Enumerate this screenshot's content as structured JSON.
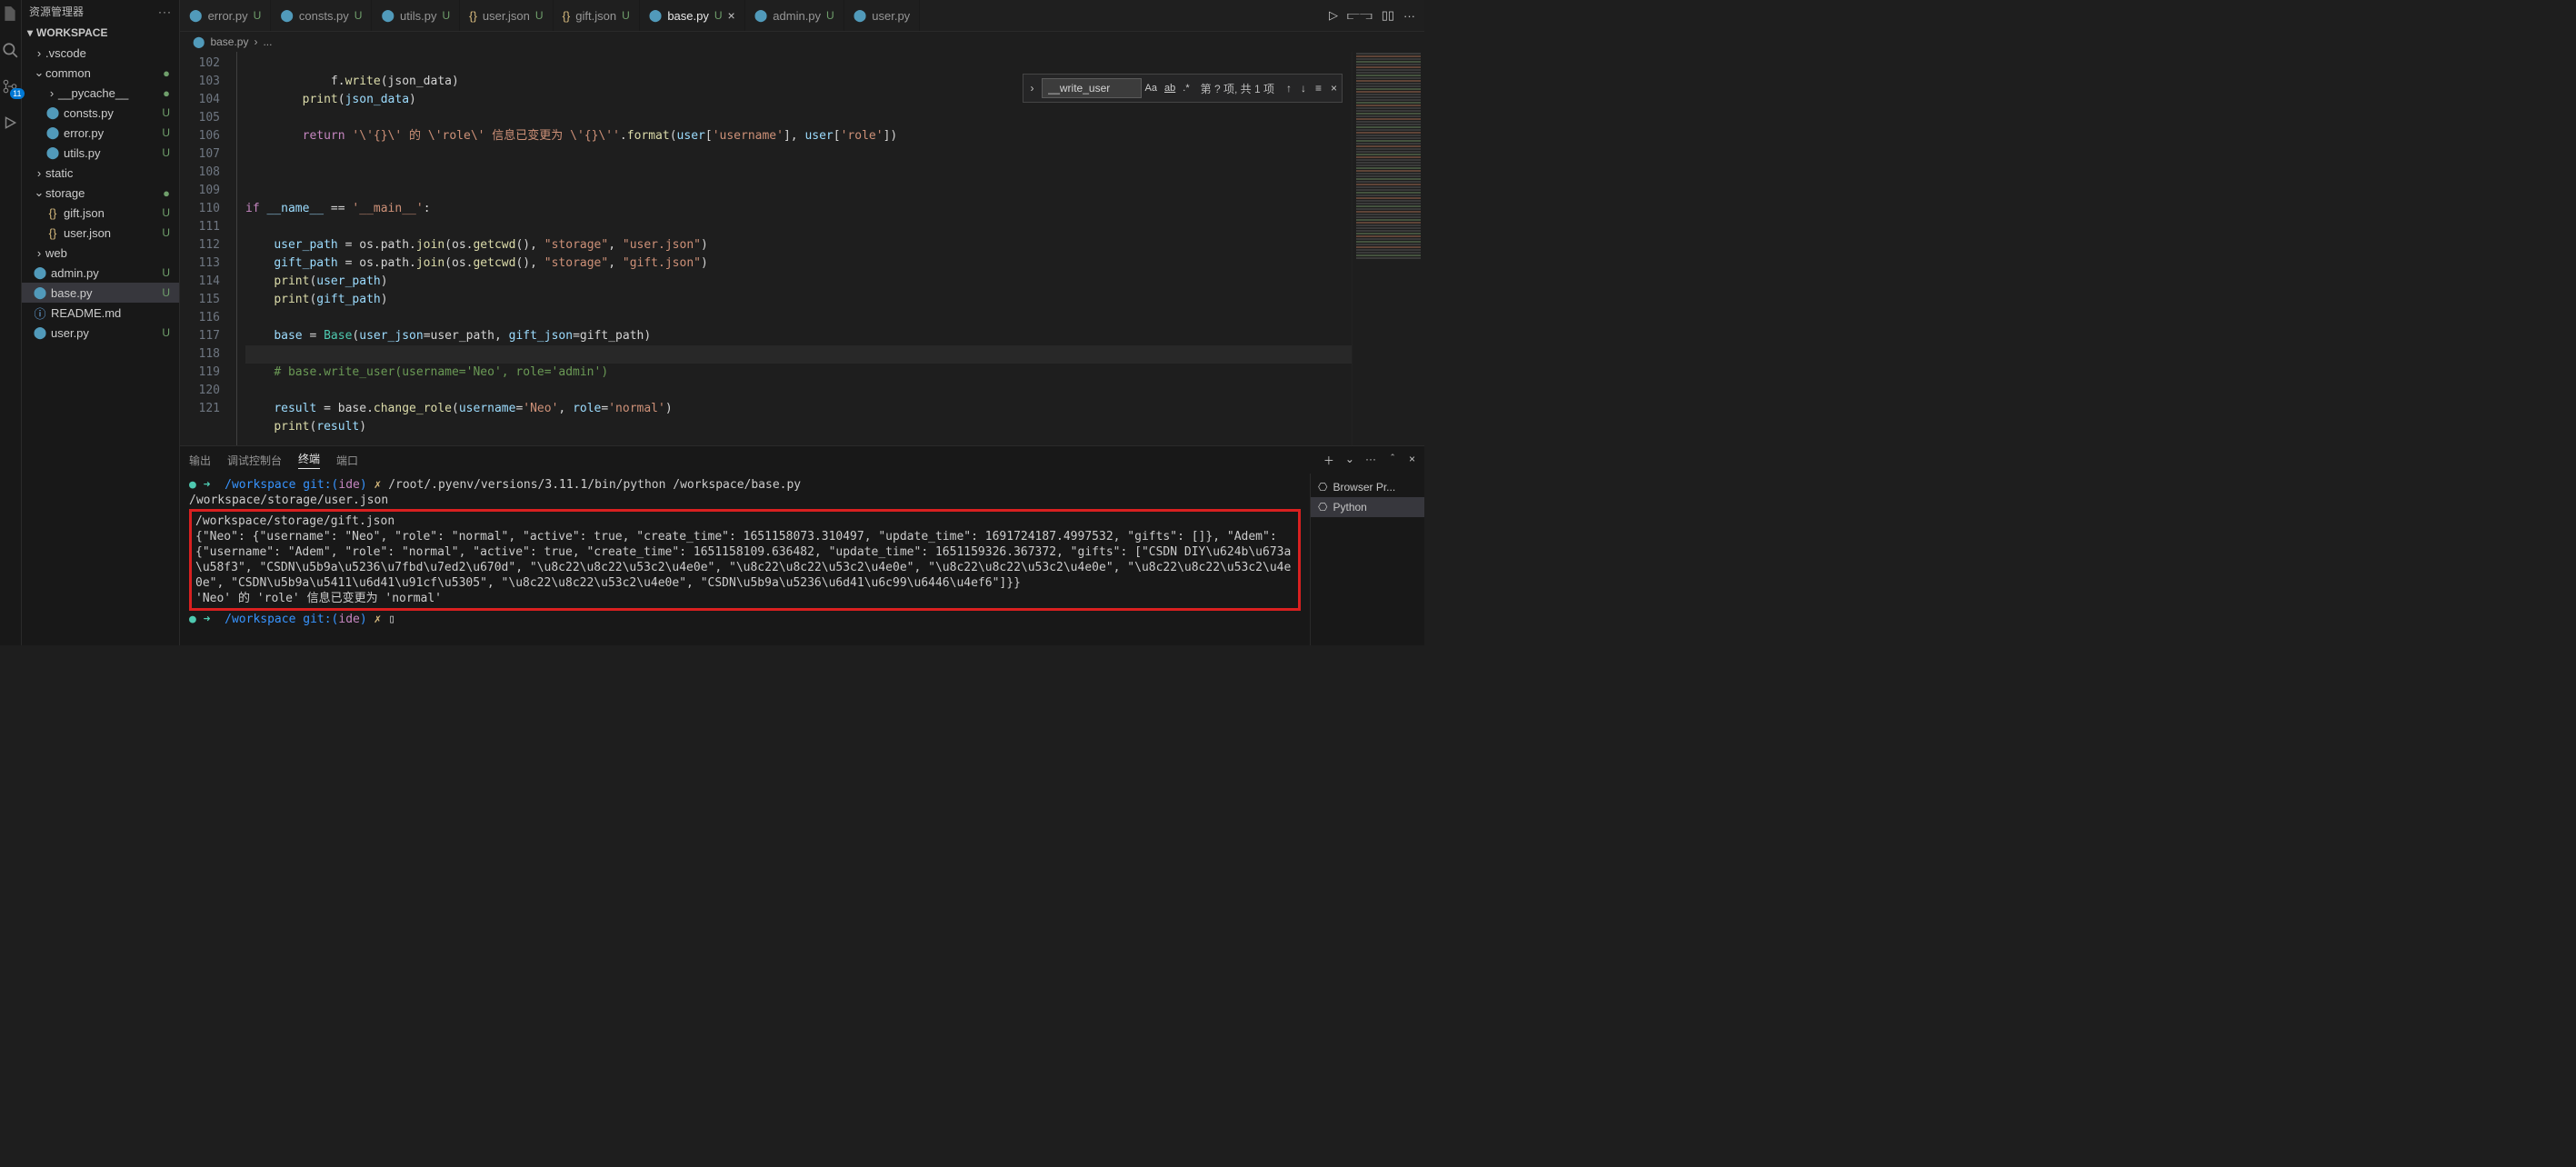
{
  "explorer_title": "资源管理器",
  "workspace_label": "WORKSPACE",
  "activity_badge": "11",
  "tree": {
    "vscode": ".vscode",
    "common": "common",
    "pycache": "__pycache__",
    "consts": "consts.py",
    "error": "error.py",
    "utils": "utils.py",
    "static": "static",
    "storage": "storage",
    "gift_json": "gift.json",
    "user_json": "user.json",
    "web": "web",
    "admin": "admin.py",
    "base": "base.py",
    "readme": "README.md",
    "user": "user.py",
    "status_U": "U",
    "status_dot": "●"
  },
  "tabs": [
    {
      "icon": "py",
      "label": "error.py",
      "status": "U"
    },
    {
      "icon": "py",
      "label": "consts.py",
      "status": "U"
    },
    {
      "icon": "py",
      "label": "utils.py",
      "status": "U"
    },
    {
      "icon": "json",
      "label": "user.json",
      "status": "U"
    },
    {
      "icon": "json",
      "label": "gift.json",
      "status": "U"
    },
    {
      "icon": "py",
      "label": "base.py",
      "status": "U",
      "active": true,
      "close": true
    },
    {
      "icon": "py",
      "label": "admin.py",
      "status": "U"
    },
    {
      "icon": "py",
      "label": "user.py"
    }
  ],
  "breadcrumb": {
    "file": "base.py",
    "sep": "›",
    "more": "..."
  },
  "find": {
    "value": "__write_user",
    "opt_case": "Aa",
    "opt_word": "ab",
    "opt_regex": ".*",
    "info": "第 ? 项, 共 1 项"
  },
  "gutter": [
    "102",
    "103",
    "104",
    "105",
    "106",
    "107",
    "108",
    "109",
    "110",
    "111",
    "112",
    "113",
    "114",
    "115",
    "116",
    "117",
    "118",
    "119",
    "120",
    "121"
  ],
  "code": {
    "l102": "            f.write(json_data)",
    "l103": "        print(json_data)",
    "l104": "",
    "l105": "        return '\\'{}\\' 的 \\'role\\' 信息已变更为 \\'{}\\''.format(user['username'], user['role'])",
    "l106": "",
    "l107": "",
    "l108": "",
    "l109": "if __name__ == '__main__':",
    "l110": "",
    "l111": "    user_path = os.path.join(os.getcwd(), \"storage\", \"user.json\")",
    "l112": "    gift_path = os.path.join(os.getcwd(), \"storage\", \"gift.json\")",
    "l113": "    print(user_path)",
    "l114": "    print(gift_path)",
    "l115": "",
    "l116": "    base = Base(user_json=user_path, gift_json=gift_path)",
    "l117": "",
    "l118": "    # base.write_user(username='Neo', role='admin')",
    "l119": "",
    "l120": "    result = base.change_role(username='Neo', role='normal')",
    "l121": "    print(result)"
  },
  "panel_tabs": {
    "output": "输出",
    "debug": "调试控制台",
    "terminal": "终端",
    "ports": "端口"
  },
  "terminal": {
    "prompt_arrow": "➜",
    "prompt_path": "/workspace",
    "prompt_git": "git:(",
    "prompt_branch": "ide",
    "prompt_git_close": ")",
    "prompt_x": "✗",
    "cmd": "/root/.pyenv/versions/3.11.1/bin/python /workspace/base.py",
    "out1": "/workspace/storage/user.json",
    "out2": "/workspace/storage/gift.json",
    "json_blob": "{\"Neo\": {\"username\": \"Neo\", \"role\": \"normal\", \"active\": true, \"create_time\": 1651158073.310497, \"update_time\": 1691724187.4997532, \"gifts\": []}, \"Adem\": {\"username\": \"Adem\", \"role\": \"normal\", \"active\": true, \"create_time\": 1651158109.636482, \"update_time\": 1651159326.367372, \"gifts\": [\"CSDN DIY\\u624b\\u673a\\u58f3\", \"CSDN\\u5b9a\\u5236\\u7fbd\\u7ed2\\u670d\", \"\\u8c22\\u8c22\\u53c2\\u4e0e\", \"\\u8c22\\u8c22\\u53c2\\u4e0e\", \"\\u8c22\\u8c22\\u53c2\\u4e0e\", \"\\u8c22\\u8c22\\u53c2\\u4e0e\", \"CSDN\\u5b9a\\u5411\\u6d41\\u91cf\\u5305\", \"\\u8c22\\u8c22\\u53c2\\u4e0e\", \"CSDN\\u5b9a\\u5236\\u6d41\\u6c99\\u6446\\u4ef6\"]}}",
    "result_line": "'Neo' 的 'role' 信息已变更为 'normal'",
    "cursor": "▯"
  },
  "term_side": {
    "browser": "Browser Pr...",
    "python": "Python"
  }
}
